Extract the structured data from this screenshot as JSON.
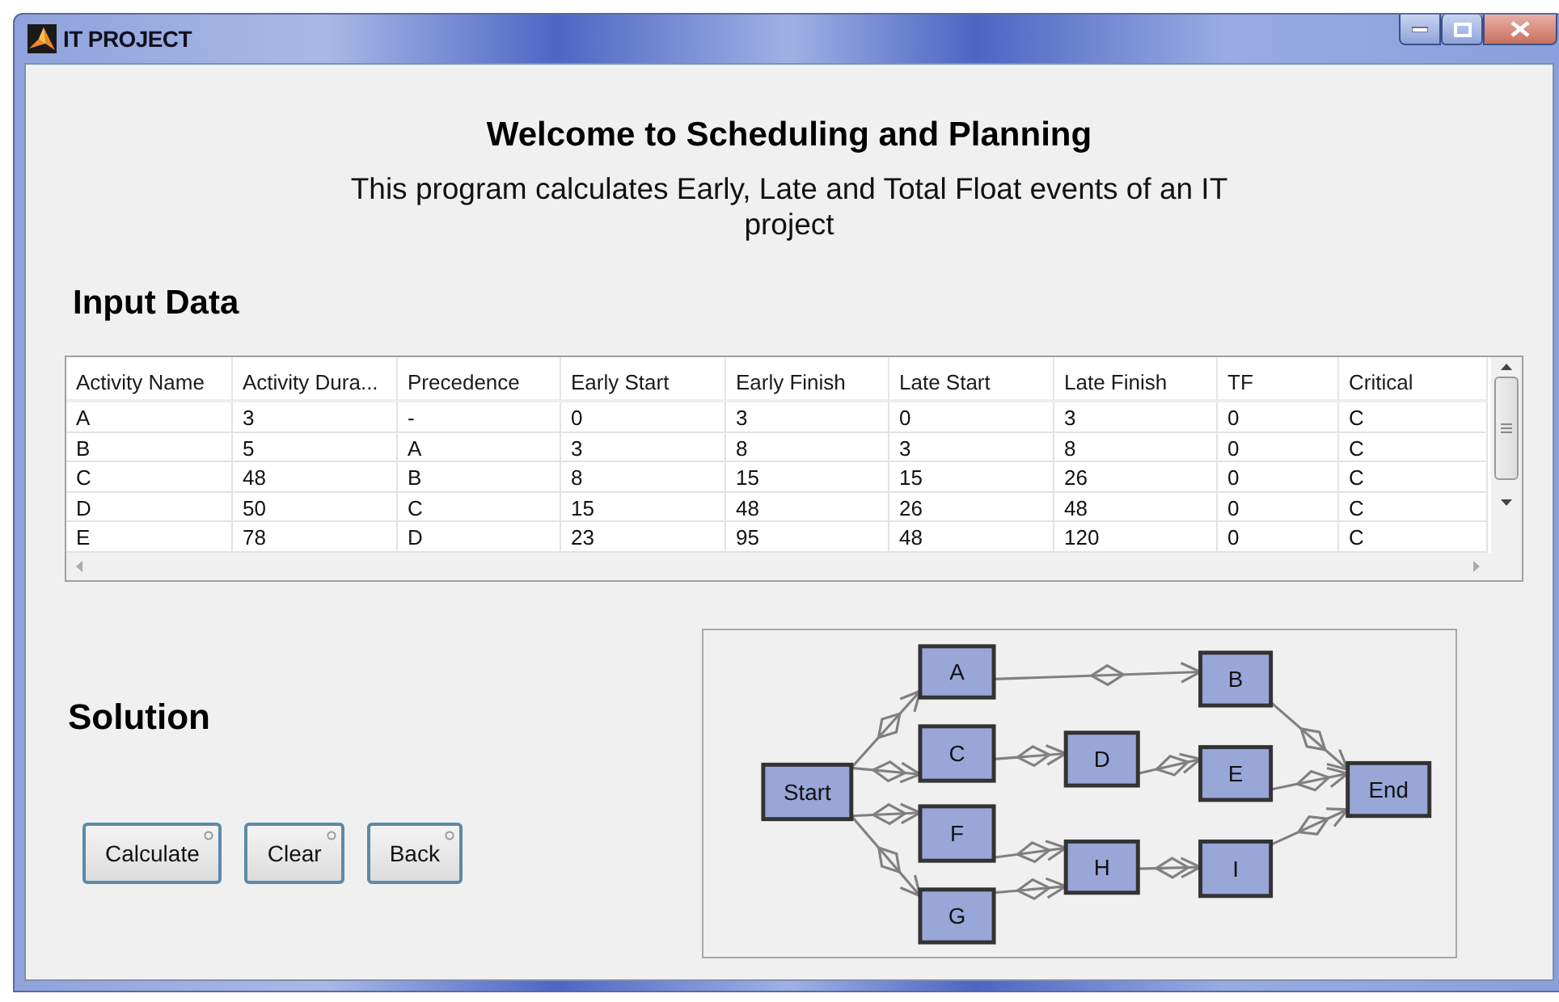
{
  "window": {
    "title": "IT PROJECT"
  },
  "heading": "Welcome to Scheduling and Planning",
  "description": "This program calculates Early, Late and Total Float events of an IT project",
  "input_section": {
    "title": "Input Data"
  },
  "table": {
    "columns": [
      "Activity Name",
      "Activity Dura...",
      "Precedence",
      "Early Start",
      "Early Finish",
      "Late Start",
      "Late Finish",
      "TF",
      "Critical"
    ],
    "rows": [
      [
        "A",
        "3",
        "-",
        "0",
        "3",
        "0",
        "3",
        "0",
        "C"
      ],
      [
        "B",
        "5",
        "A",
        "3",
        "8",
        "3",
        "8",
        "0",
        "C"
      ],
      [
        "C",
        "48",
        "B",
        "8",
        "15",
        "15",
        "26",
        "0",
        "C"
      ],
      [
        "D",
        "50",
        "C",
        "15",
        "48",
        "26",
        "48",
        "0",
        "C"
      ],
      [
        "E",
        "78",
        "D",
        "23",
        "95",
        "48",
        "120",
        "0",
        "C"
      ]
    ]
  },
  "solution": {
    "title": "Solution",
    "buttons": [
      "Calculate",
      "Clear",
      "Back"
    ]
  },
  "diagram": {
    "nodes": [
      {
        "label": "Start"
      },
      {
        "label": "A"
      },
      {
        "label": "B"
      },
      {
        "label": "C"
      },
      {
        "label": "D"
      },
      {
        "label": "E"
      },
      {
        "label": "End"
      },
      {
        "label": "F"
      },
      {
        "label": "G"
      },
      {
        "label": "H"
      },
      {
        "label": "I"
      }
    ]
  }
}
